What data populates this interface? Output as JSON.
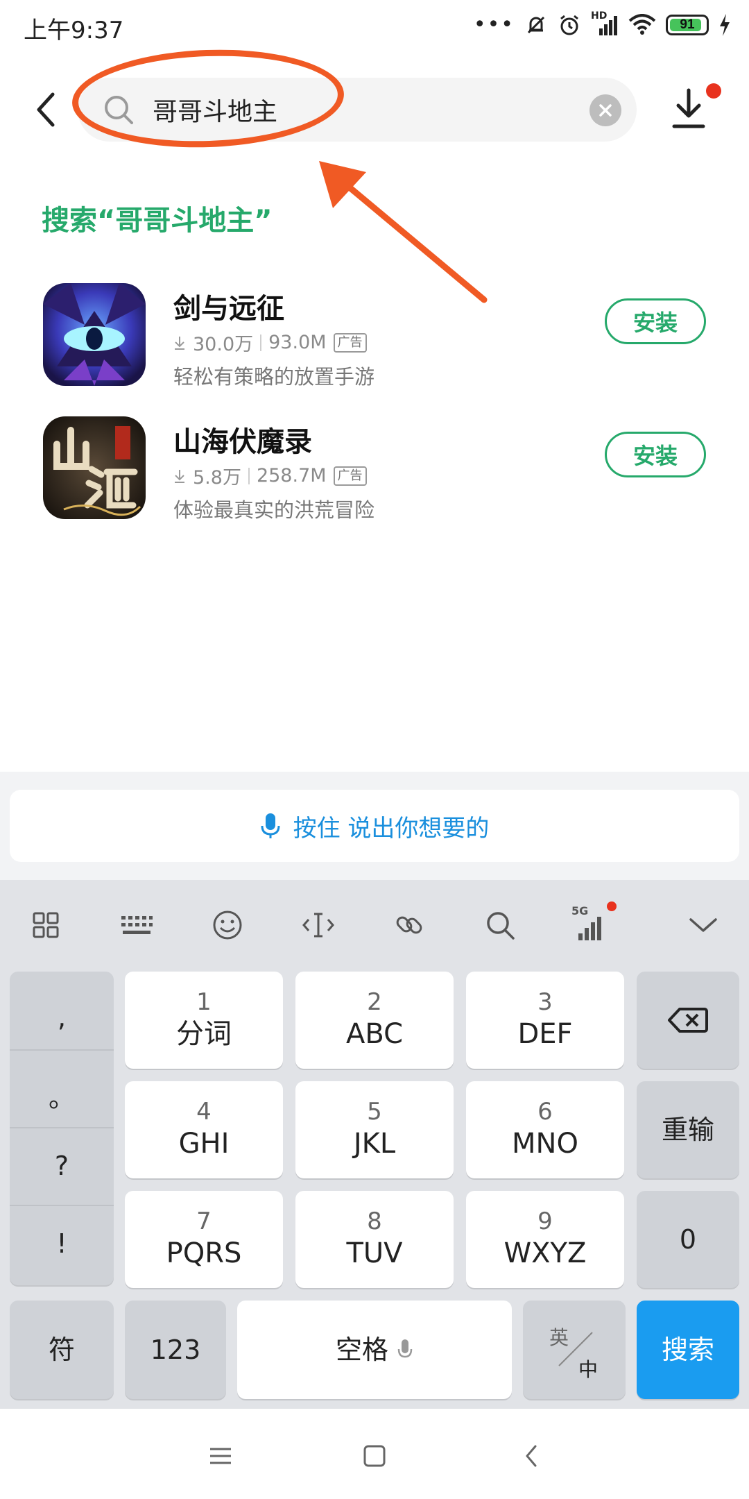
{
  "status_bar": {
    "time": "上午9:37",
    "battery": "91",
    "network": "HD"
  },
  "search": {
    "query": "哥哥斗地主",
    "placeholder": ""
  },
  "suggestion": "搜索“哥哥斗地主”",
  "apps": [
    {
      "name": "剑与远征",
      "downloads": "30.0万",
      "size": "93.0M",
      "ad": "广告",
      "desc": "轻松有策略的放置手游",
      "install": "安装"
    },
    {
      "name": "山海伏魔录",
      "downloads": "5.8万",
      "size": "258.7M",
      "ad": "广告",
      "desc": "体验最真实的洪荒冒险",
      "install": "安装"
    }
  ],
  "voice_bar": {
    "label": "按住 说出你想要的"
  },
  "keyboard": {
    "toolbar": [
      "grid-icon",
      "keyboard-icon",
      "emoji-icon",
      "cursor-icon",
      "link-icon",
      "search-icon",
      "5g-signal-icon",
      "chevron-down-icon"
    ],
    "toolbar_5g": "5G",
    "punctuation": [
      ",",
      "。",
      "?",
      "!"
    ],
    "keys": [
      {
        "num": "1",
        "label": "分词"
      },
      {
        "num": "2",
        "label": "ABC"
      },
      {
        "num": "3",
        "label": "DEF"
      },
      {
        "num": "4",
        "label": "GHI"
      },
      {
        "num": "5",
        "label": "JKL"
      },
      {
        "num": "6",
        "label": "MNO"
      },
      {
        "num": "7",
        "label": "PQRS"
      },
      {
        "num": "8",
        "label": "TUV"
      },
      {
        "num": "9",
        "label": "WXYZ"
      }
    ],
    "reenter": "重输",
    "zero": "0",
    "symbols": "符",
    "numbers": "123",
    "space": "空格",
    "lang_top": "英",
    "lang_bottom": "中",
    "search": "搜索"
  },
  "colors": {
    "accent_green": "#26a96b",
    "annotation": "#f05a24",
    "keyboard_blue": "#1a9cf0"
  }
}
